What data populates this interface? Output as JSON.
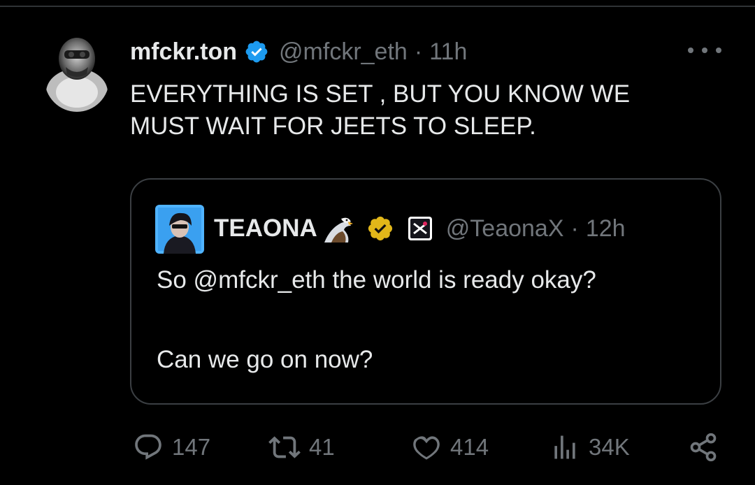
{
  "tweet": {
    "display_name": "mfckr.ton",
    "handle": "@mfckr_eth",
    "separator": "·",
    "time": "11h",
    "text_line1": "EVERYTHING IS SET , BUT YOU KNOW WE",
    "text_line2": "MUST WAIT FOR JEETS TO SLEEP."
  },
  "quote": {
    "display_name": "TEAONA",
    "handle": "@TeaonaX",
    "separator": "·",
    "time": "12h",
    "line1": "So @mfckr_eth the world is ready okay?",
    "line2": "Can we go on now?"
  },
  "actions": {
    "replies": "147",
    "reposts": "41",
    "likes": "414",
    "views": "34K"
  },
  "icons": [
    "verified-badge-icon",
    "eagle-emoji-icon",
    "gold-verified-badge-icon",
    "affiliate-badge-icon",
    "more-icon",
    "reply-icon",
    "repost-icon",
    "like-icon",
    "views-icon",
    "share-icon"
  ],
  "colors": {
    "background": "#000000",
    "text": "#e7e9ea",
    "secondary": "#71767b",
    "verified_blue": "#1d9bf0",
    "gold_badge": "#e2b719",
    "border": "#3b3f43"
  }
}
